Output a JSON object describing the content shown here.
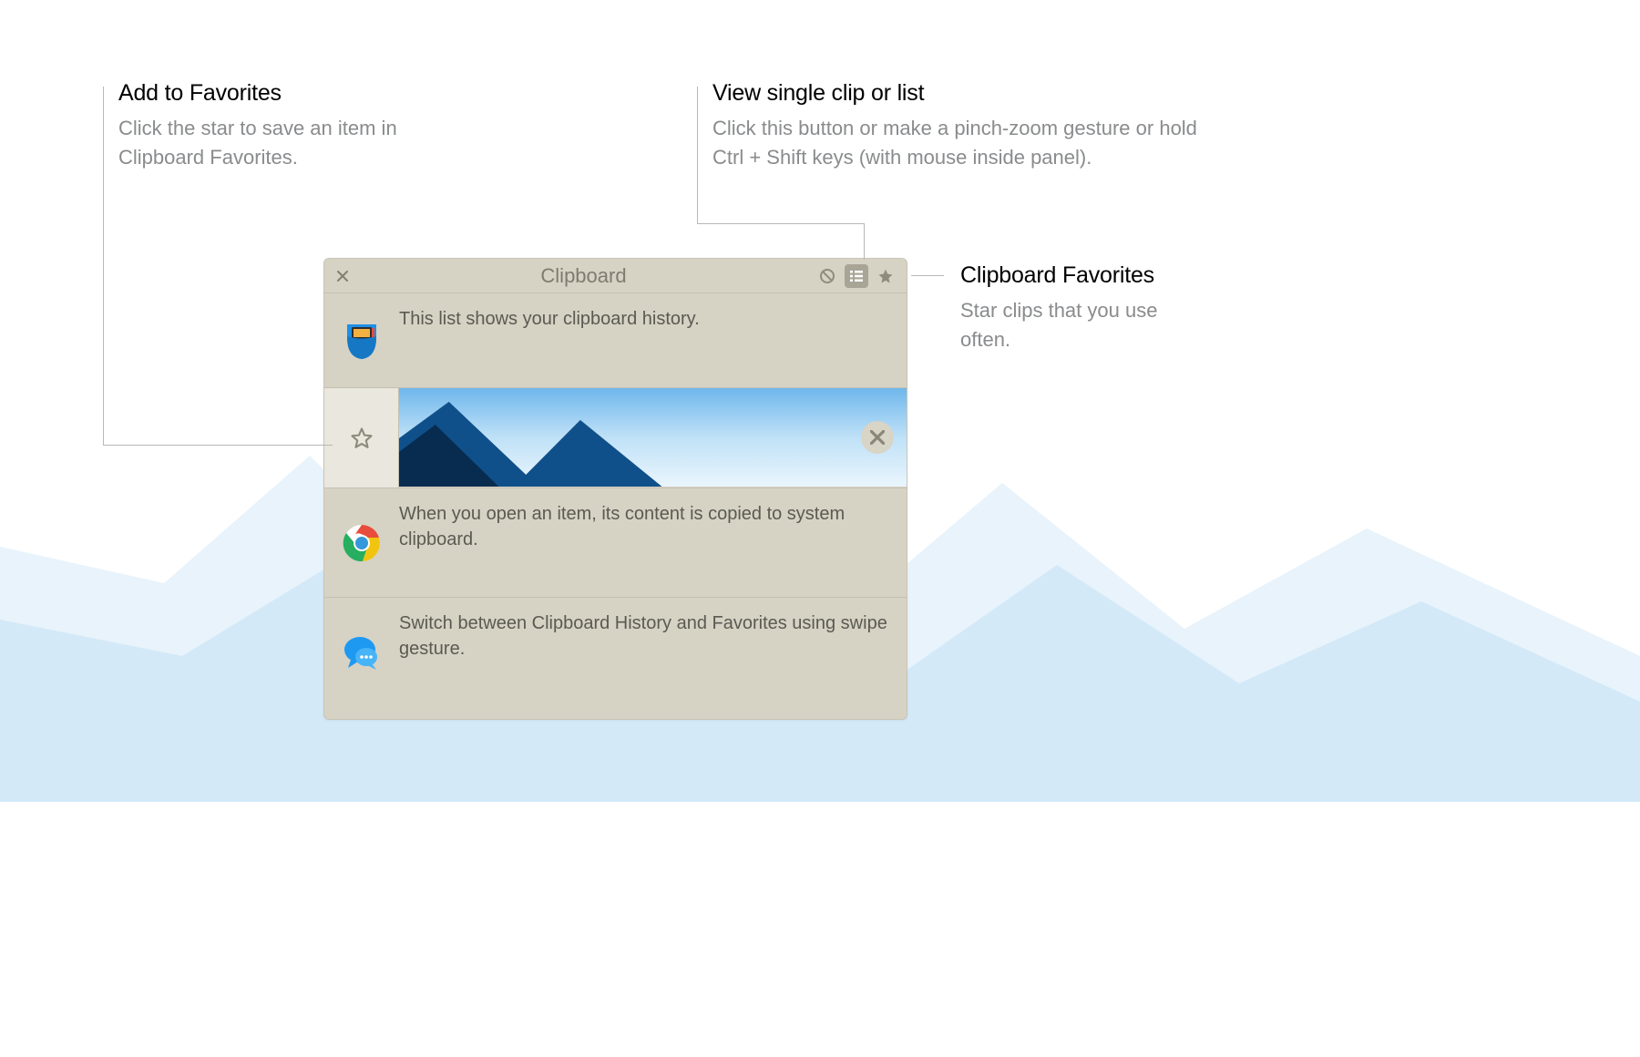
{
  "callouts": {
    "favorites": {
      "title": "Add to Favorites",
      "body": "Click the star to save an item in Clipboard Favorites."
    },
    "viewmode": {
      "title": "View single clip or list",
      "body": "Click this button or make a pinch-zoom gesture or hold Ctrl + Shift keys (with mouse inside panel)."
    },
    "clipfav": {
      "title": "Clipboard Favorites",
      "body": "Star clips that you use often."
    }
  },
  "panel": {
    "title": "Clipboard",
    "header_icons": {
      "close": "close-icon",
      "clear": "clear-icon",
      "list": "list-icon",
      "star": "star-icon"
    },
    "rows": [
      {
        "icon": "pocket-app-icon",
        "text": "This list shows your clipboard history.",
        "type": "text"
      },
      {
        "icon": "star-outline-icon",
        "text": "",
        "type": "image",
        "selected": true,
        "delete_icon": "close-icon"
      },
      {
        "icon": "chrome-app-icon",
        "text": "When you open an item, its content is copied to system clipboard.",
        "type": "text"
      },
      {
        "icon": "messages-app-icon",
        "text": "Switch between Clipboard History and Favorites using swipe gesture.",
        "type": "text"
      }
    ]
  }
}
